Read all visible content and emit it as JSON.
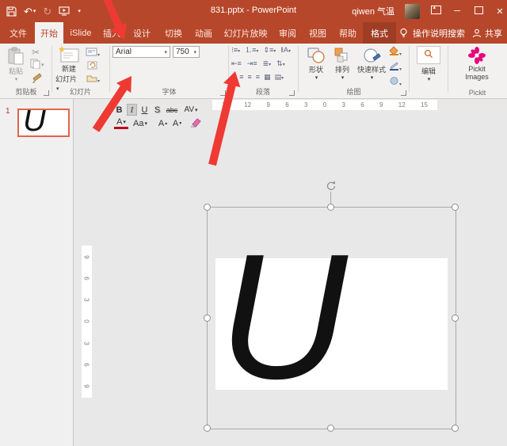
{
  "titlebar": {
    "title": "831.pptx - PowerPoint",
    "user": "qiwen 气温"
  },
  "tabs": [
    "文件",
    "开始",
    "iSlide",
    "插入",
    "设计",
    "切换",
    "动画",
    "幻灯片放映",
    "审阅",
    "视图",
    "帮助",
    "格式"
  ],
  "assistant": {
    "tell_me": "操作说明搜索",
    "share": "共享"
  },
  "ribbon": {
    "clipboard": {
      "group": "剪贴板",
      "paste": "粘贴"
    },
    "slides": {
      "group": "幻灯片",
      "new_slide_line1": "新建",
      "new_slide_line2": "幻灯片"
    },
    "font": {
      "group": "字体",
      "family": "Arial",
      "size": "750",
      "bold": "B",
      "italic": "I",
      "underline": "U",
      "shadow": "S",
      "strikethrough": "abc",
      "spacing": "AV",
      "color": "A",
      "case": "Aa",
      "grow": "A",
      "shrink": "A"
    },
    "paragraph": {
      "group": "段落"
    },
    "drawing": {
      "group": "绘图",
      "shapes": "形状",
      "arrange": "排列",
      "quick_styles": "快速样式"
    },
    "editing": {
      "label": "编辑"
    },
    "pickit": {
      "group": "Pickit",
      "line1": "Pickit",
      "line2": "Images"
    }
  },
  "slide_panel": {
    "slide_number": "1",
    "thumb_text": "U"
  },
  "canvas": {
    "text": "U"
  },
  "rulers": {
    "horizontal": [
      "15",
      "12",
      "9",
      "6",
      "3",
      "0",
      "3",
      "6",
      "9",
      "12",
      "15"
    ],
    "vertical": [
      "9",
      "6",
      "3",
      "0",
      "3",
      "6",
      "9"
    ]
  },
  "colors": {
    "titlebar": "#b7472a",
    "annotation_arrow": "#ee3a33",
    "pickit_pink": "#e6067c",
    "selection_border": "#e2654a"
  }
}
